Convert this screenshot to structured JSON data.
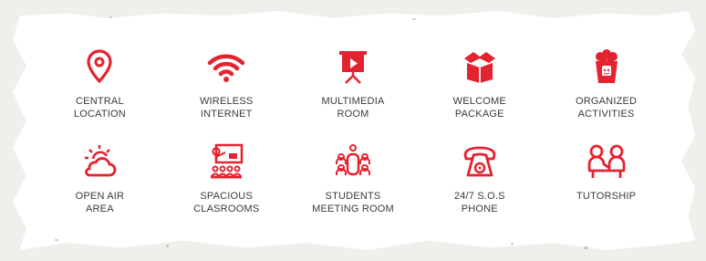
{
  "colors": {
    "accent": "#e3232f",
    "text": "#3a3a3a",
    "background": "#ffffff"
  },
  "amenities": [
    {
      "icon": "map-pin-icon",
      "label": "CENTRAL\nLOCATION"
    },
    {
      "icon": "wifi-icon",
      "label": "WIRELESS\nINTERNET"
    },
    {
      "icon": "projector-screen-icon",
      "label": "MULTIMEDIA\nROOM"
    },
    {
      "icon": "package-box-icon",
      "label": "WELCOME\nPACKAGE"
    },
    {
      "icon": "popcorn-icon",
      "label": "ORGANIZED\nACTIVITIES"
    },
    {
      "icon": "sun-cloud-icon",
      "label": "OPEN AIR\nAREA"
    },
    {
      "icon": "classroom-icon",
      "label": "SPACIOUS\nCLASROOMS"
    },
    {
      "icon": "meeting-table-icon",
      "label": "STUDENTS\nMEETING ROOM"
    },
    {
      "icon": "telephone-icon",
      "label": "24/7 S.O.S\nPHONE"
    },
    {
      "icon": "tutor-icon",
      "label": "TUTORSHIP"
    }
  ]
}
